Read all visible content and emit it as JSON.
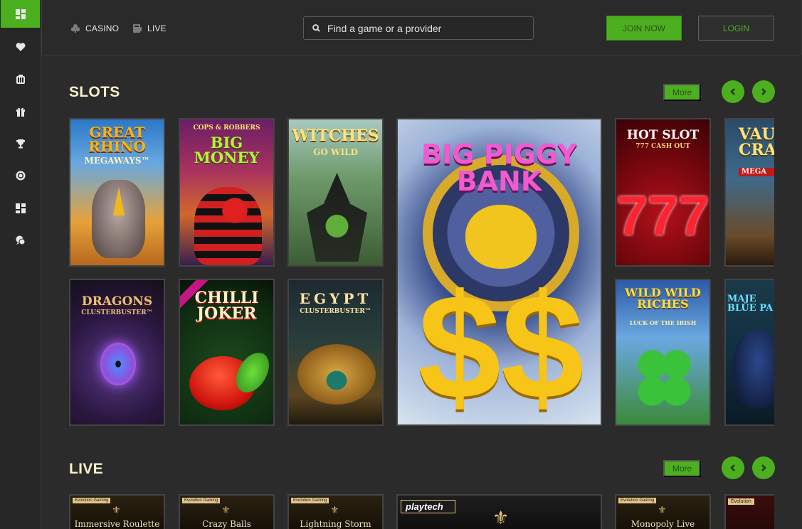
{
  "header": {
    "nav": [
      {
        "label": "CASINO",
        "icon": "club-icon"
      },
      {
        "label": "LIVE",
        "icon": "live-icon"
      }
    ],
    "search_placeholder": "Find a game or a provider",
    "join_label": "JOIN NOW",
    "login_label": "LOGIN"
  },
  "sidebar": {
    "items": [
      {
        "icon": "dashboard-icon",
        "active": true
      },
      {
        "icon": "heart-icon"
      },
      {
        "icon": "casino-chips-icon"
      },
      {
        "icon": "gift-icon"
      },
      {
        "icon": "trophy-icon"
      },
      {
        "icon": "chip-icon"
      },
      {
        "icon": "grid-icon"
      },
      {
        "icon": "chat-icon"
      }
    ]
  },
  "slots": {
    "title": "SLOTS",
    "more_label": "More",
    "games": [
      {
        "name": "GREAT RHINO",
        "sub": "MEGAWAYS™"
      },
      {
        "name": "BIG MONEY",
        "sub": "COPS & ROBBERS"
      },
      {
        "name": "WITCHES",
        "sub": "GO WILD"
      },
      {
        "name": "BIG PIGGY BANK",
        "sub": ""
      },
      {
        "name": "HOT SLOT",
        "sub": "777 CASH OUT"
      },
      {
        "name": "VAU CRAC",
        "sub": "MEGA"
      },
      {
        "name": "DRAGONS",
        "sub": "CLUSTERBUSTER™"
      },
      {
        "name": "CHILLI JOKER",
        "sub": "EXCLUSIVE"
      },
      {
        "name": "EGYPT",
        "sub": "CLUSTERBUSTER™"
      },
      {
        "name": "WILD WILD RICHES",
        "sub": "LUCK OF THE IRISH"
      },
      {
        "name": "MAJE BLUE PA",
        "sub": ""
      }
    ]
  },
  "live": {
    "title": "LIVE",
    "more_label": "More",
    "games": [
      {
        "name": "Immersive Roulette",
        "badge": "Evolution Gaming"
      },
      {
        "name": "Crazy Balls",
        "badge": "Evolution Gaming"
      },
      {
        "name": "Lightning Storm",
        "badge": "Evolution Gaming"
      },
      {
        "name": "",
        "badge": "playtech"
      },
      {
        "name": "Monopoly Live",
        "badge": "Evolution Gaming"
      },
      {
        "name": "",
        "badge": "Evolution"
      }
    ]
  },
  "colors": {
    "accent": "#4caf1f",
    "title": "#f5f0c8",
    "bg": "#2b2b2b"
  }
}
